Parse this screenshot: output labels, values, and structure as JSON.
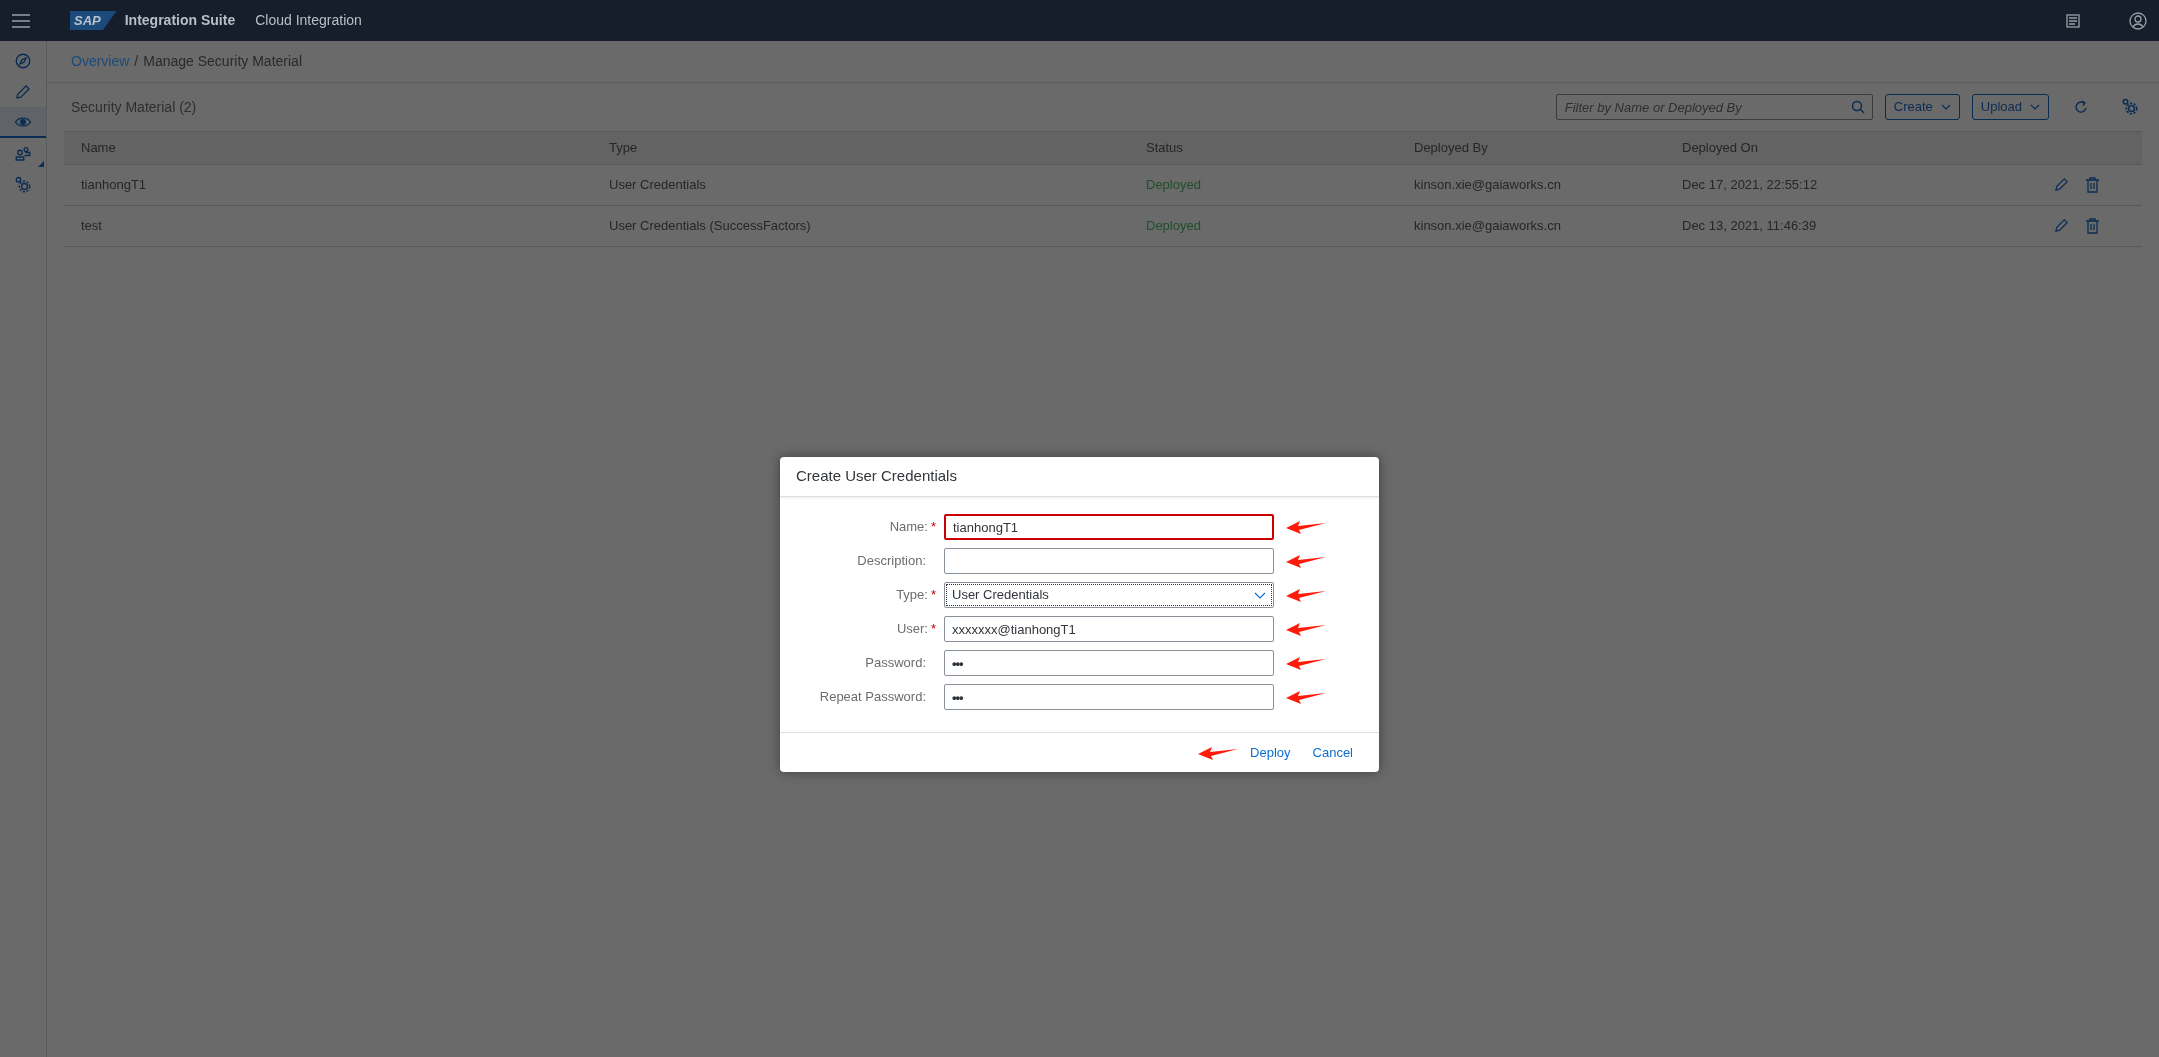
{
  "shell_bar": {
    "logo": "SAP",
    "product": "Integration Suite",
    "area": "Cloud Integration"
  },
  "sidebar": {
    "items": [
      {
        "selected": false,
        "expandable": false
      },
      {
        "selected": false,
        "expandable": false
      },
      {
        "selected": true,
        "expandable": false
      },
      {
        "selected": false,
        "expandable": true
      },
      {
        "selected": false,
        "expandable": false
      }
    ]
  },
  "breadcrumb": {
    "link": "Overview",
    "separator": "/",
    "current": "Manage Security Material"
  },
  "toolbar": {
    "title": "Security Material (2)",
    "filter": {
      "placeholder": "Filter by Name or Deployed By"
    },
    "buttons": [
      "Create",
      "Upload"
    ]
  },
  "table": {
    "columns": [
      "Name",
      "Type",
      "Status",
      "Deployed By",
      "Deployed On"
    ],
    "rows": [
      {
        "cells": [
          "tianhongT1",
          "User Credentials",
          "Deployed",
          "kinson.xie@gaiaworks.cn",
          "Dec 17, 2021, 22:55:12"
        ]
      },
      {
        "cells": [
          "test",
          "User Credentials (SuccessFactors)",
          "Deployed",
          "kinson.xie@gaiaworks.cn",
          "Dec 13, 2021, 11:46:39"
        ]
      }
    ]
  },
  "dialog": {
    "title": "Create User Credentials",
    "required_mark": "*",
    "fields": [
      {
        "label": "Name:",
        "kind": "text",
        "value": "tianhongT1",
        "required": true,
        "error": true,
        "marked": true
      },
      {
        "label": "Description:",
        "kind": "text",
        "required": false,
        "error": false,
        "marked": true
      },
      {
        "label": "Type:",
        "kind": "select",
        "value": "User Credentials",
        "required": true,
        "error": false,
        "marked": true
      },
      {
        "label": "User:",
        "kind": "text",
        "value": "xxxxxxx@tianhongT1",
        "required": true,
        "error": false,
        "marked": true
      },
      {
        "label": "Password:",
        "kind": "password",
        "value": "•••",
        "required": false,
        "error": false,
        "marked": true
      },
      {
        "label": "Repeat Password:",
        "kind": "password",
        "value": "•••",
        "required": false,
        "error": false,
        "marked": true
      }
    ],
    "buttons": [
      {
        "label": "Deploy",
        "marked": true
      },
      {
        "label": "Cancel",
        "marked": false
      }
    ]
  }
}
